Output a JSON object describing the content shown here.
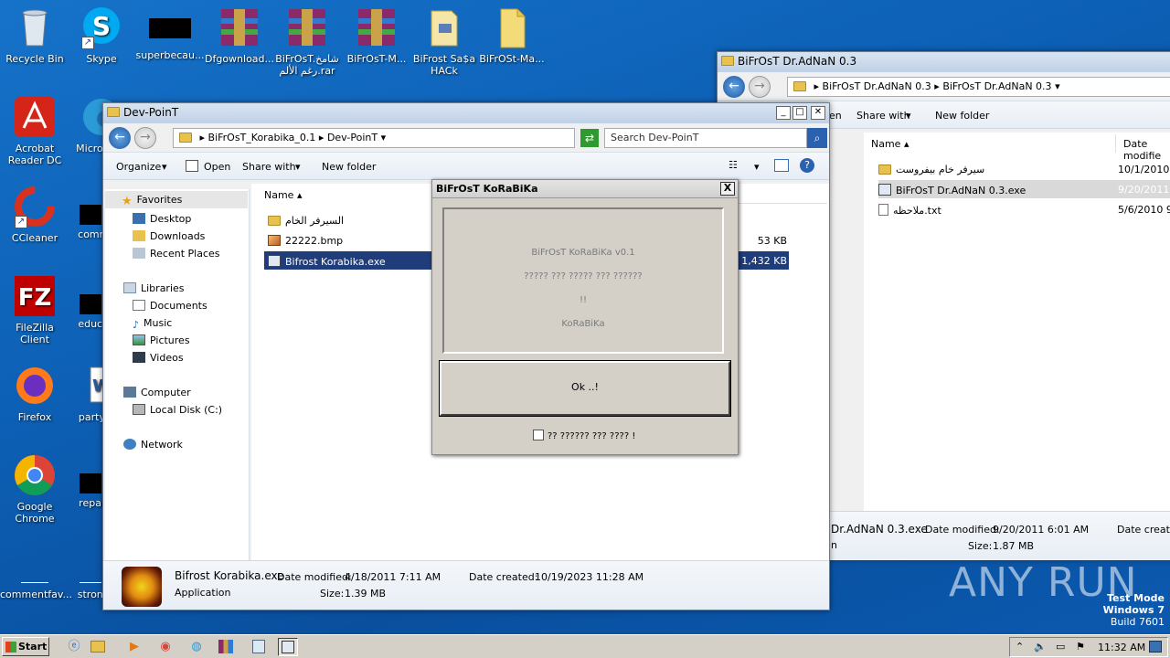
{
  "desktop_icons": [
    {
      "name": "recycle-bin",
      "label": "Recycle Bin"
    },
    {
      "name": "skype",
      "label": "Skype"
    },
    {
      "name": "superbecau",
      "label": "superbecau..."
    },
    {
      "name": "dfgownload",
      "label": "Dfgownload..."
    },
    {
      "name": "bifrost-rar",
      "label": "BiFrOsT.شامخ رغم الألم.rar"
    },
    {
      "name": "bifrost-m",
      "label": "BiFrOsT-M..."
    },
    {
      "name": "bifrost-saa",
      "label": "BiFrost Sa$a HACk"
    },
    {
      "name": "bifrost-ma",
      "label": "BiFrOSt-Ma..."
    },
    {
      "name": "acrobat",
      "label": "Acrobat Reader DC"
    },
    {
      "name": "microsoft",
      "label": "Microsof..."
    },
    {
      "name": "ccleaner",
      "label": "CCleaner"
    },
    {
      "name": "commu",
      "label": "commu..."
    },
    {
      "name": "filezilla",
      "label": "FileZilla Client"
    },
    {
      "name": "educati",
      "label": "educati..."
    },
    {
      "name": "firefox",
      "label": "Firefox"
    },
    {
      "name": "partyfe",
      "label": "partyfe..."
    },
    {
      "name": "chrome",
      "label": "Google Chrome"
    },
    {
      "name": "repairg",
      "label": "repairg..."
    },
    {
      "name": "commentfav",
      "label": "commentfav..."
    },
    {
      "name": "strongu",
      "label": "strongu..."
    }
  ],
  "back_window": {
    "title": "BiFrOsT Dr.AdNaN 0.3",
    "breadcrumb": [
      "BiFrOsT Dr.AdNaN 0.3",
      "BiFrOsT Dr.AdNaN 0.3"
    ],
    "toolbar": {
      "share": "Share with",
      "new_folder": "New folder",
      "partial": "en"
    },
    "columns": {
      "name": "Name",
      "date": "Date modifie"
    },
    "files": [
      {
        "name": "سيرفر خام بيفروست",
        "date": "10/1/2010 5",
        "type": "folder"
      },
      {
        "name": "BiFrOsT Dr.AdNaN 0.3.exe",
        "date": "9/20/2011 6",
        "type": "exe",
        "selected": true
      },
      {
        "name": "ملاحظه.txt",
        "date": "5/6/2010 9:",
        "type": "txt"
      }
    ],
    "details": {
      "name": "Dr.AdNaN 0.3.exe",
      "modified_label": "Date modified:",
      "modified": "9/20/2011 6:01 AM",
      "created_label": "Date created",
      "size_label": "Size:",
      "size": "1.87 MB",
      "partial": "n"
    }
  },
  "main_window": {
    "title": "Dev-PoinT",
    "breadcrumb": [
      "BiFrOsT_Korabika_0.1",
      "Dev-PoinT"
    ],
    "search_placeholder": "Search Dev-PoinT",
    "toolbar": {
      "organize": "Organize",
      "open": "Open",
      "share": "Share with",
      "new_folder": "New folder"
    },
    "nav": {
      "favorites": "Favorites",
      "favorites_items": [
        "Desktop",
        "Downloads",
        "Recent Places"
      ],
      "libraries": "Libraries",
      "libraries_items": [
        "Documents",
        "Music",
        "Pictures",
        "Videos"
      ],
      "computer": "Computer",
      "computer_items": [
        "Local Disk (C:)"
      ],
      "network": "Network"
    },
    "columns": {
      "name": "Name"
    },
    "files": [
      {
        "name": "السيرفر الخام",
        "size": "",
        "type": "folder"
      },
      {
        "name": "22222.bmp",
        "size": "53 KB",
        "type": "bmp"
      },
      {
        "name": "Bifrost Korabika.exe",
        "size": "1,432 KB",
        "type": "exe",
        "selected": true
      }
    ],
    "details": {
      "name": "Bifrost Korabika.exe",
      "type": "Application",
      "modified_label": "Date modified:",
      "modified": "4/18/2011 7:11 AM",
      "created_label": "Date created:",
      "created": "10/19/2023 11:28 AM",
      "size_label": "Size:",
      "size": "1.39 MB"
    }
  },
  "dialog": {
    "title": "BiFrOsT KoRaBiKa",
    "close": "X",
    "lines": [
      "BiFrOsT KoRaBiKa v0.1",
      "?????  ??? ????? ??? ??????",
      "!!",
      "KoRaBiKa"
    ],
    "ok_button": "Ok ..!",
    "checkbox_label": "?? ?????? ??? ???? !"
  },
  "taskbar": {
    "start": "Start",
    "clock": "11:32 AM"
  },
  "watermark": "ANY RUN",
  "test_mode": {
    "line1": "Test Mode",
    "line2": "Windows 7",
    "line3": "Build 7601"
  },
  "colors": {
    "desktop": "#0c5fb4",
    "selection": "#1f3d7a",
    "dialog": "#d4d0c8"
  }
}
